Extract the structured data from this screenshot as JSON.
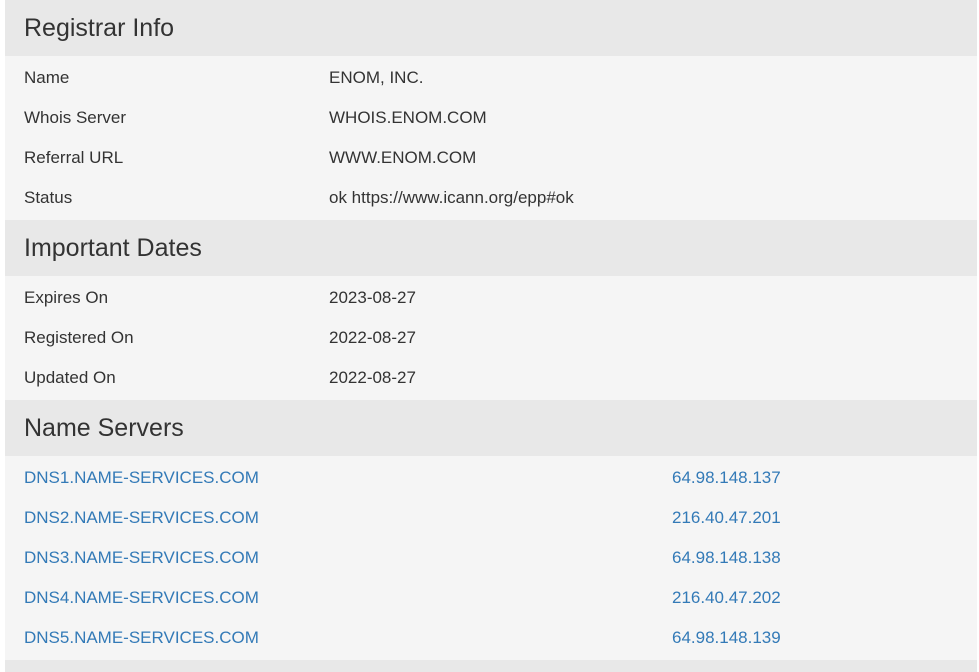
{
  "registrar": {
    "title": "Registrar Info",
    "rows": [
      {
        "label": "Name",
        "value": "ENOM, INC."
      },
      {
        "label": "Whois Server",
        "value": "WHOIS.ENOM.COM"
      },
      {
        "label": "Referral URL",
        "value": "WWW.ENOM.COM"
      },
      {
        "label": "Status",
        "value": "ok https://www.icann.org/epp#ok"
      }
    ]
  },
  "dates": {
    "title": "Important Dates",
    "rows": [
      {
        "label": "Expires On",
        "value": "2023-08-27"
      },
      {
        "label": "Registered On",
        "value": "2022-08-27"
      },
      {
        "label": "Updated On",
        "value": "2022-08-27"
      }
    ]
  },
  "nameservers": {
    "title": "Name Servers",
    "rows": [
      {
        "host": "DNS1.NAME-SERVICES.COM",
        "ip": "64.98.148.137"
      },
      {
        "host": "DNS2.NAME-SERVICES.COM",
        "ip": "216.40.47.201"
      },
      {
        "host": "DNS3.NAME-SERVICES.COM",
        "ip": "64.98.148.138"
      },
      {
        "host": "DNS4.NAME-SERVICES.COM",
        "ip": "216.40.47.202"
      },
      {
        "host": "DNS5.NAME-SERVICES.COM",
        "ip": "64.98.148.139"
      }
    ]
  },
  "colors": {
    "link": "#337ab7",
    "header_bg": "#e8e8e8",
    "panel_bg": "#f5f5f5",
    "text": "#333333"
  }
}
